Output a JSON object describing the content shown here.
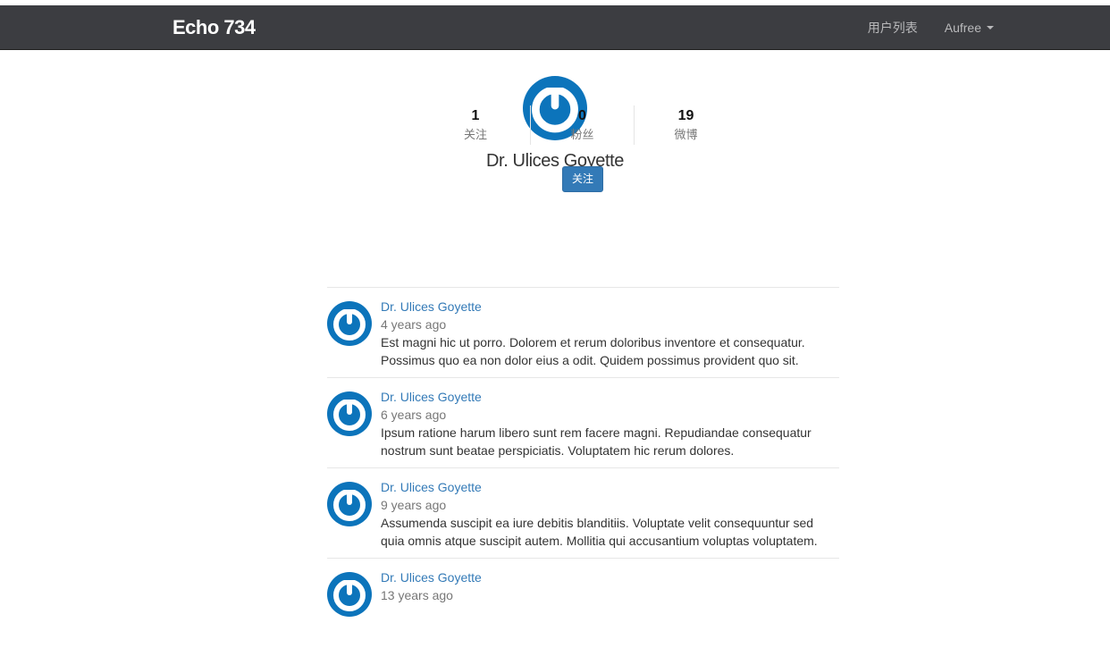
{
  "navbar": {
    "brand": "Echo 734",
    "links": {
      "users": "用户列表",
      "account": "Aufree"
    }
  },
  "profile": {
    "name": "Dr. Ulices Goyette",
    "stats": [
      {
        "value": "1",
        "label": "关注"
      },
      {
        "value": "0",
        "label": "粉丝"
      },
      {
        "value": "19",
        "label": "微博"
      }
    ],
    "follow_button": "关注"
  },
  "feed": {
    "posts": [
      {
        "author": "Dr. Ulices Goyette",
        "time": "4 years ago",
        "text": "Est magni hic ut porro. Dolorem et rerum doloribus inventore et consequatur. Possimus quo ea non dolor eius a odit. Quidem possimus provident quo sit."
      },
      {
        "author": "Dr. Ulices Goyette",
        "time": "6 years ago",
        "text": "Ipsum ratione harum libero sunt rem facere magni. Repudiandae consequatur nostrum sunt beatae perspiciatis. Voluptatem hic rerum dolores."
      },
      {
        "author": "Dr. Ulices Goyette",
        "time": "9 years ago",
        "text": "Assumenda suscipit ea iure debitis blanditiis. Voluptate velit consequuntur sed quia omnis atque suscipit autem. Mollitia qui accusantium voluptas voluptatem."
      },
      {
        "author": "Dr. Ulices Goyette",
        "time": "13 years ago",
        "text": ""
      }
    ]
  },
  "colors": {
    "navbar_bg": "#3c3d41",
    "accent": "#337ab7",
    "avatar_blue": "#0c74bb"
  },
  "icons": {
    "avatar": "gravatar-power-logo",
    "dropdown": "caret-down-icon"
  }
}
